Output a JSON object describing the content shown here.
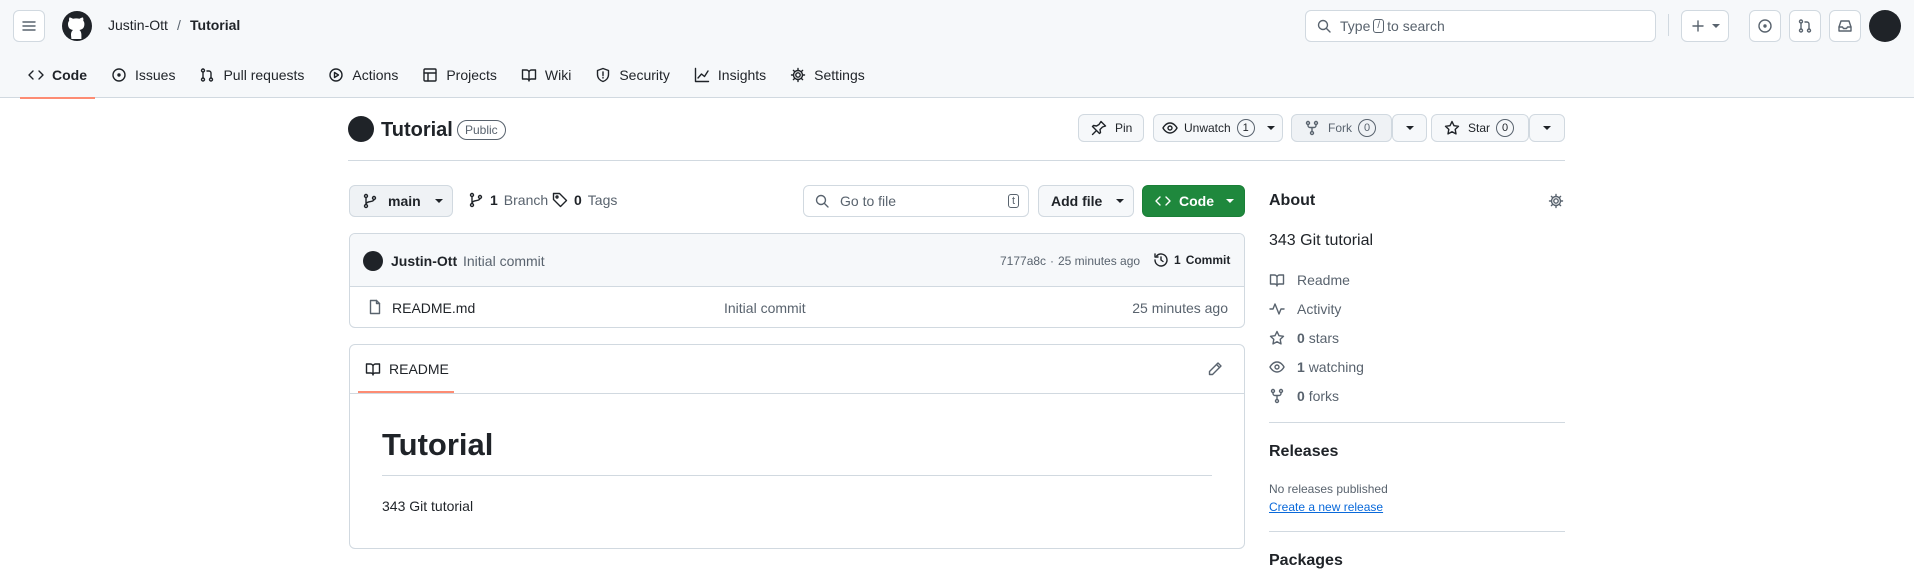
{
  "header": {
    "owner": "Justin-Ott",
    "separator": "/",
    "repo": "Tutorial",
    "search_prefix": "Type",
    "search_key": "/",
    "search_suffix": "to search"
  },
  "tabs": [
    {
      "label": "Code",
      "icon": "code-icon"
    },
    {
      "label": "Issues",
      "icon": "issue-icon"
    },
    {
      "label": "Pull requests",
      "icon": "pull-request-icon"
    },
    {
      "label": "Actions",
      "icon": "play-icon"
    },
    {
      "label": "Projects",
      "icon": "table-icon"
    },
    {
      "label": "Wiki",
      "icon": "book-icon"
    },
    {
      "label": "Security",
      "icon": "shield-icon"
    },
    {
      "label": "Insights",
      "icon": "graph-icon"
    },
    {
      "label": "Settings",
      "icon": "gear-icon"
    }
  ],
  "repo": {
    "name": "Tutorial",
    "visibility": "Public",
    "pin_label": "Pin",
    "unwatch_label": "Unwatch",
    "watch_count": "1",
    "fork_label": "Fork",
    "fork_count": "0",
    "star_label": "Star",
    "star_count": "0"
  },
  "toolbar": {
    "branch": "main",
    "branches_count": "1",
    "branches_label": "Branch",
    "tags_count": "0",
    "tags_label": "Tags",
    "goto_placeholder": "Go to file",
    "goto_key": "t",
    "add_file_label": "Add file",
    "code_label": "Code"
  },
  "commit": {
    "author": "Justin-Ott",
    "message": "Initial commit",
    "hash": "7177a8c",
    "time": "25 minutes ago",
    "commits_count": "1",
    "commits_label": "Commit"
  },
  "files": [
    {
      "name": "README.md",
      "message": "Initial commit",
      "time": "25 minutes ago"
    }
  ],
  "readme": {
    "tab_label": "README",
    "heading": "Tutorial",
    "body": "343 Git tutorial"
  },
  "about": {
    "title": "About",
    "description": "343 Git tutorial",
    "items": [
      {
        "icon": "book-icon",
        "count": "",
        "label": "Readme"
      },
      {
        "icon": "pulse-icon",
        "count": "",
        "label": "Activity"
      },
      {
        "icon": "star-icon",
        "count": "0",
        "label": "stars"
      },
      {
        "icon": "eye-icon",
        "count": "1",
        "label": "watching"
      },
      {
        "icon": "fork-icon",
        "count": "0",
        "label": "forks"
      }
    ]
  },
  "releases": {
    "title": "Releases",
    "empty_text": "No releases published",
    "create_link": "Create a new release"
  },
  "packages": {
    "title": "Packages"
  },
  "colors": {
    "accent_underline": "#fd8c73",
    "code_button": "#1f883d",
    "link": "#0969da",
    "header_bg": "#f6f8fa"
  }
}
